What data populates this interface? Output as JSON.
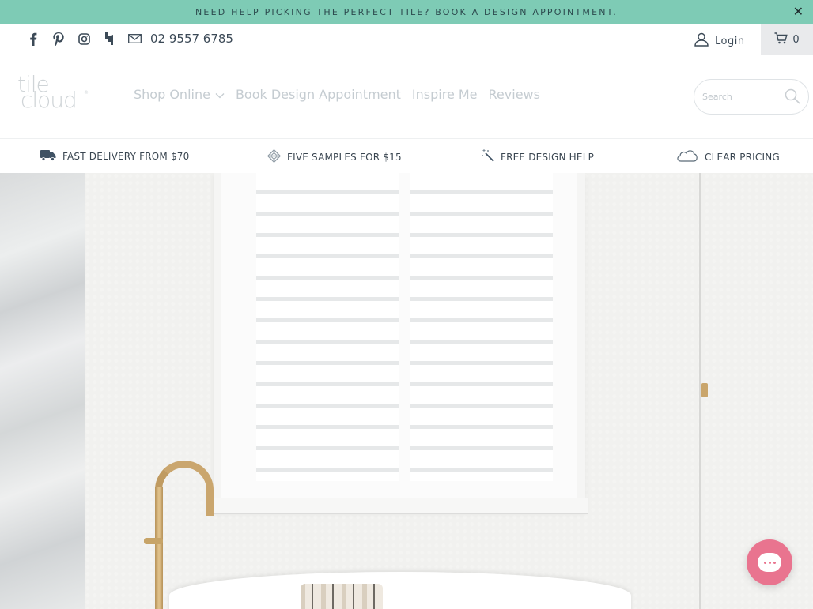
{
  "announcement": {
    "text": "NEED HELP PICKING THE PERFECT TILE? BOOK A DESIGN APPOINTMENT.",
    "close_icon": "close-icon"
  },
  "topbar": {
    "social_icons": [
      "facebook-icon",
      "pinterest-icon",
      "instagram-icon",
      "houzz-icon",
      "mail-icon"
    ],
    "phone": "02 9557 6785",
    "login_label": "Login",
    "cart_count": "0"
  },
  "nav": {
    "logo_line1": "tile",
    "logo_line2": "cloud",
    "logo_reg": "®",
    "menu": [
      {
        "label": "Shop Online"
      },
      {
        "label": "Book Design Appointment"
      },
      {
        "label": "Inspire Me"
      },
      {
        "label": "Reviews"
      }
    ],
    "search_placeholder": "Search"
  },
  "usps": [
    {
      "label": "FAST DELIVERY FROM $70",
      "icon": "truck-icon"
    },
    {
      "label": "FIVE SAMPLES FOR $15",
      "icon": "tile-samples-icon"
    },
    {
      "label": "FREE DESIGN HELP",
      "icon": "magic-wand-icon"
    },
    {
      "label": "CLEAR PRICING",
      "icon": "cloud-icon"
    }
  ],
  "colors": {
    "announcement_bg": "#7ecbb5",
    "chat_button": "#e9748f",
    "cart_bg": "#e9eaec"
  }
}
